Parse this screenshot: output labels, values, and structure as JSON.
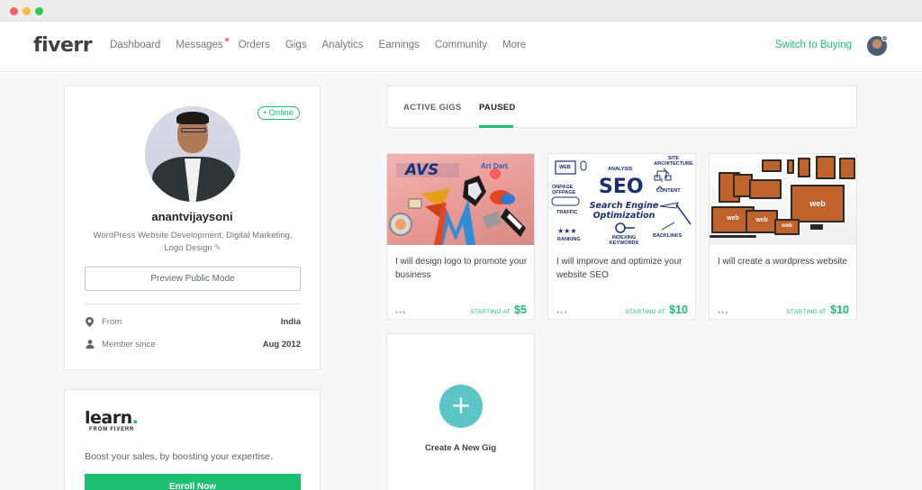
{
  "header": {
    "logo": "fiverr",
    "nav": [
      "Dashboard",
      "Messages",
      "Orders",
      "Gigs",
      "Analytics",
      "Earnings",
      "Community",
      "More"
    ],
    "switch_label": "Switch to Buying"
  },
  "profile": {
    "status": "• Online",
    "username": "anantvijaysoni",
    "tagline": "WordPress Website Development, Digital Marketing, Logo Design",
    "preview_label": "Preview Public Mode",
    "from_label": "From",
    "from_value": "India",
    "since_label": "Member since",
    "since_value": "Aug 2012"
  },
  "learn": {
    "logo": "learn",
    "logo_dot": ".",
    "sub": "FROM FIVERR",
    "text": "Boost your sales, by boosting your expertise.",
    "button": "Enroll Now"
  },
  "tabs": {
    "active": "ACTIVE GIGS",
    "paused": "PAUSED"
  },
  "gigs": [
    {
      "title": "I will design logo to promote your business",
      "price_label": "STARTING AT",
      "price": "$5",
      "image_text": {
        "brand": "AVS",
        "tag": "Art Dart"
      }
    },
    {
      "title": "I will improve and optimize your website SEO",
      "price_label": "STARTING AT",
      "price": "$10",
      "image_text": {
        "big": "SEO",
        "sub": "Search Engine Optimization",
        "web": "WEB",
        "analysis": "ANALYSIS",
        "site": "SITE ARCHITECTURE",
        "onpage": "ONPAGE OFFPAGE",
        "content": "CONTENT",
        "traffic": "TRAFFIC",
        "ranking": "RANKING",
        "indexing": "INDEXING KEYWORDS",
        "backlinks": "BACKLINKS"
      }
    },
    {
      "title": "I will create a wordpress website",
      "price_label": "STARTING AT",
      "price": "$10",
      "image_text": {
        "web": "web"
      }
    }
  ],
  "new_gig": {
    "plus": "+",
    "label": "Create A New Gig"
  },
  "icons": {
    "from": "location-pin-icon",
    "since": "user-icon",
    "edit": "pencil-icon",
    "more": "more-dots-icon"
  },
  "colors": {
    "brand_green": "#1dbf73",
    "plus_teal": "#5bc4c4",
    "notification_pink": "#ff62ad"
  }
}
